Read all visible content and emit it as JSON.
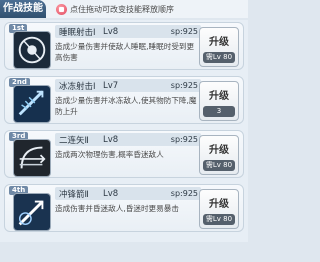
{
  "header": {
    "title": "作战技能",
    "hint": "点住拖动可改变技能释放顺序"
  },
  "skills": [
    {
      "rank": "1st",
      "name": "睡眠射击Ⅰ",
      "level": "Lv8",
      "sp": "sp:925",
      "desc": "造成少量伤害并使敌人睡眠,睡眠时受到更高伤害",
      "upgrade_label": "升级",
      "requirement": "需Lv 80",
      "icon": "sleep-shot-icon"
    },
    {
      "rank": "2nd",
      "name": "冰冻射击Ⅰ",
      "level": "Lv7",
      "sp": "sp:925",
      "desc": "造成少量伤害并冰冻敌人,使其物防下降,魔防上升",
      "upgrade_label": "升级",
      "requirement": "3",
      "icon": "freeze-shot-icon"
    },
    {
      "rank": "3rd",
      "name": "二连矢Ⅱ",
      "level": "Lv8",
      "sp": "sp:925",
      "desc": "造成两次物理伤害,概率昏迷敌人",
      "upgrade_label": "升级",
      "requirement": "需Lv 80",
      "icon": "double-arrow-icon"
    },
    {
      "rank": "4th",
      "name": "冲锋箭Ⅱ",
      "level": "Lv8",
      "sp": "sp:925",
      "desc": "造成伤害并昏迷敌人,昏迷时更易暴击",
      "upgrade_label": "升级",
      "requirement": "需Lv 80",
      "icon": "charge-arrow-icon"
    }
  ]
}
